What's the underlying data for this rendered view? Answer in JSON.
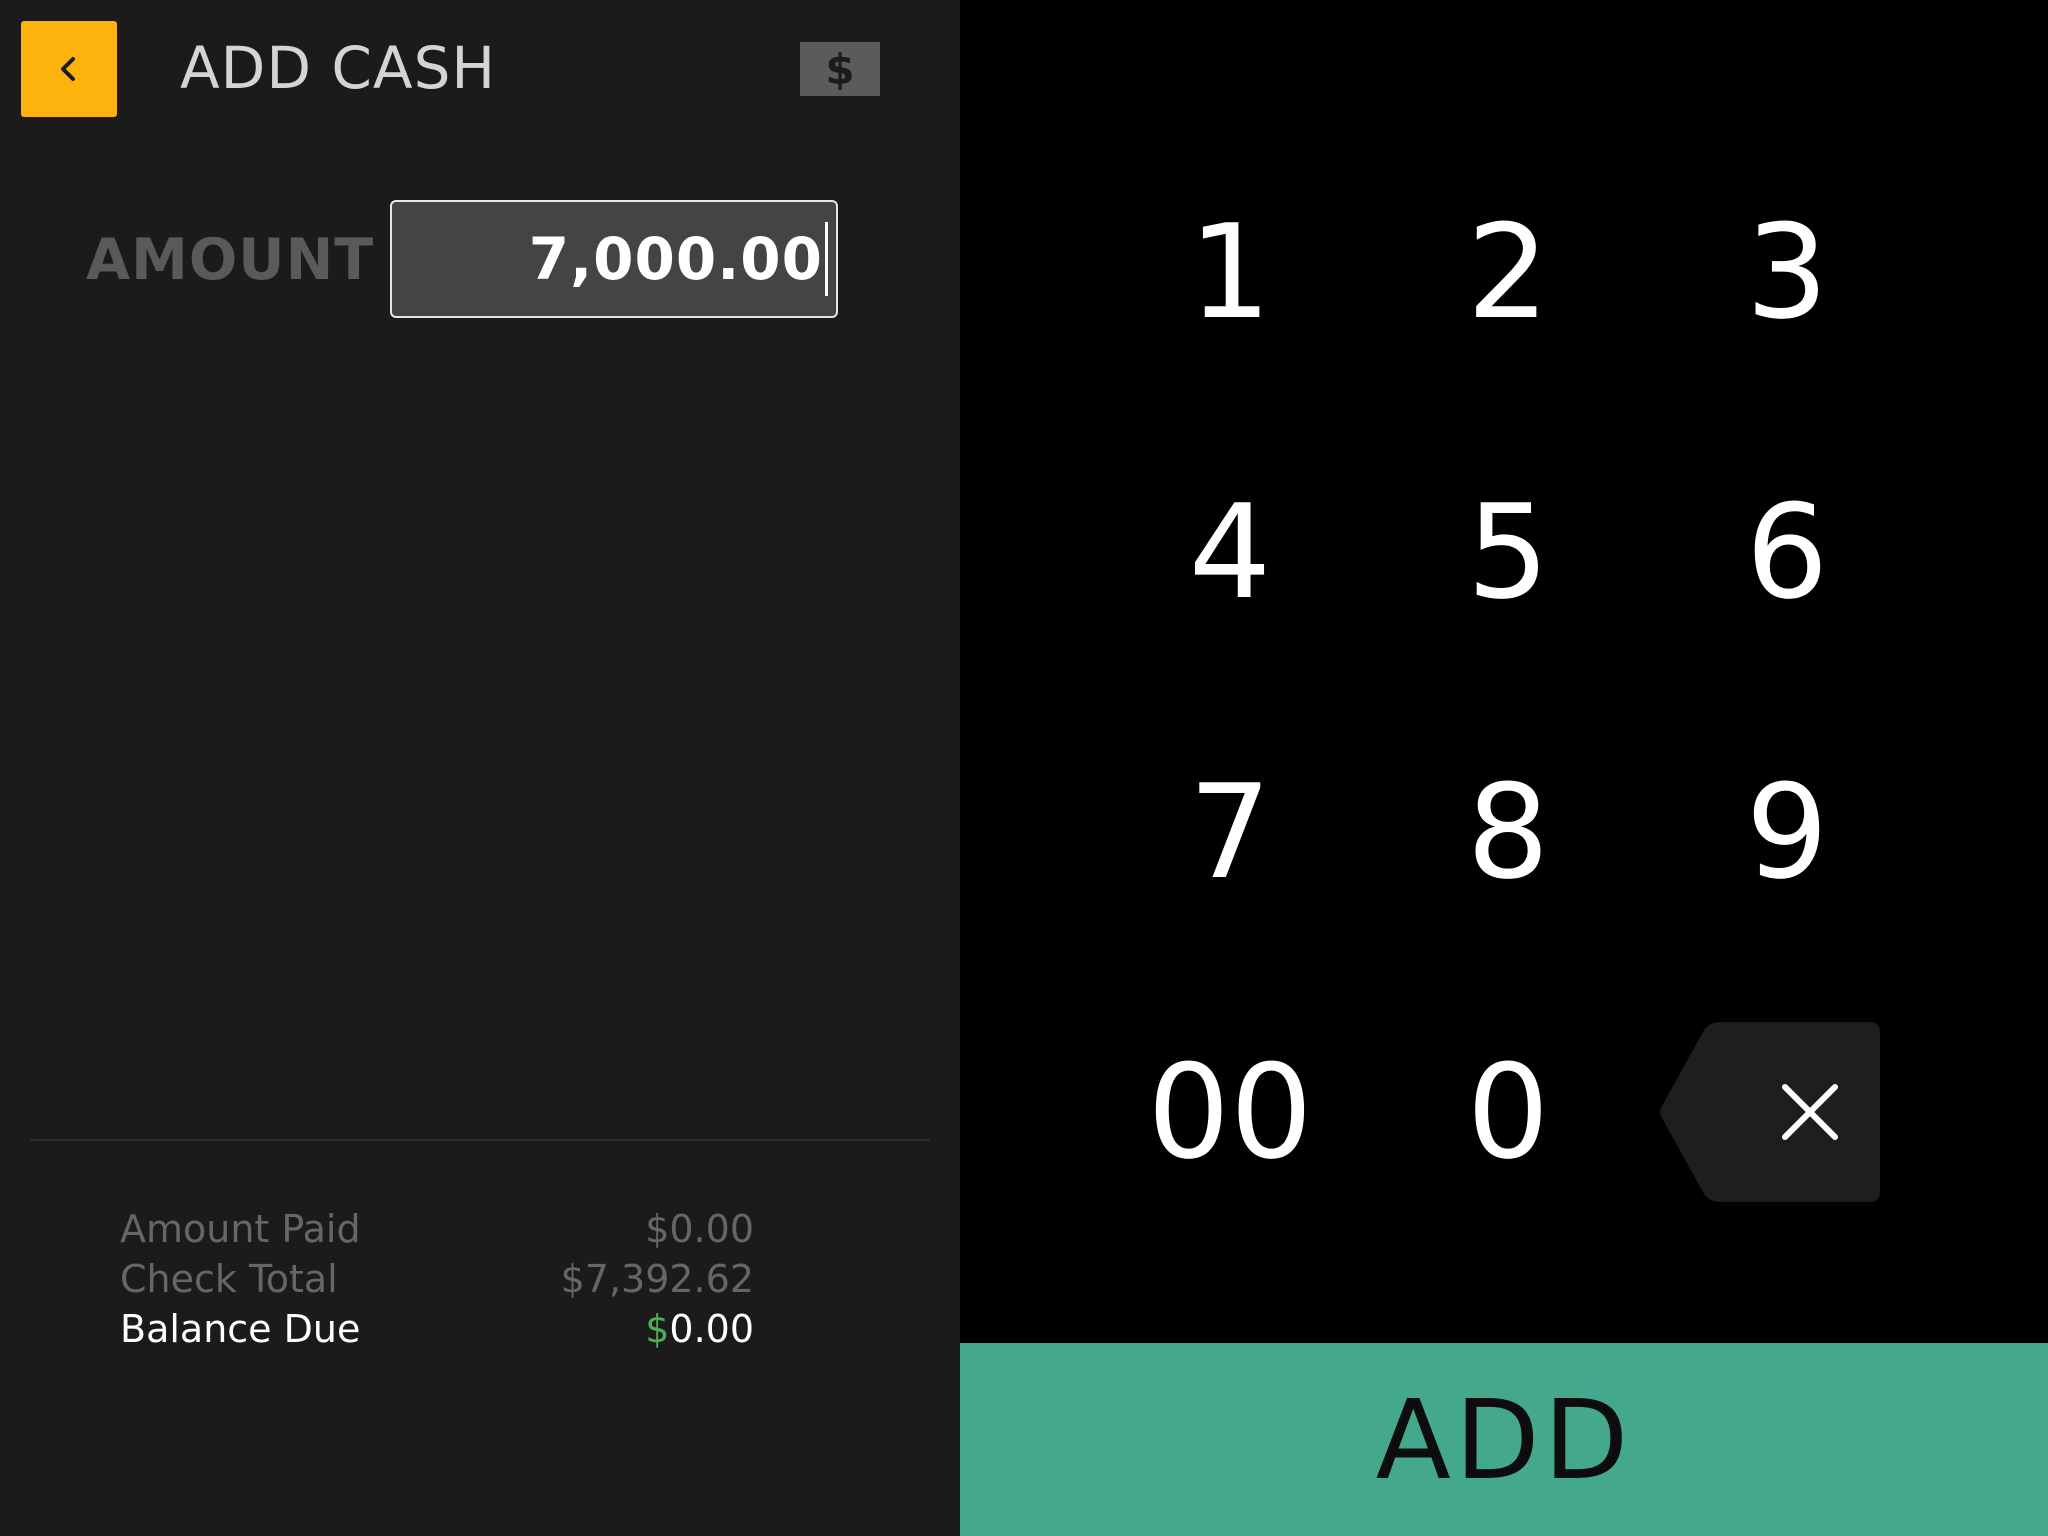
{
  "header": {
    "title": "ADD CASH",
    "back_icon": "chevron-left-icon",
    "currency_symbol": "$"
  },
  "amount": {
    "label": "AMOUNT",
    "value": "7,000.00"
  },
  "summary": {
    "amount_paid_label": "Amount Paid",
    "amount_paid_value": "$0.00",
    "check_total_label": "Check Total",
    "check_total_value": "$7,392.62",
    "balance_due_label": "Balance Due",
    "balance_due_symbol": "$",
    "balance_due_value": "0.00"
  },
  "keypad": {
    "keys": [
      "1",
      "2",
      "3",
      "4",
      "5",
      "6",
      "7",
      "8",
      "9",
      "00",
      "0"
    ],
    "backspace_icon": "backspace-icon"
  },
  "action": {
    "add_label": "ADD"
  },
  "colors": {
    "back_button": "#fcb40d",
    "add_button": "#44a98c",
    "balance_dollar": "#4caf50"
  }
}
